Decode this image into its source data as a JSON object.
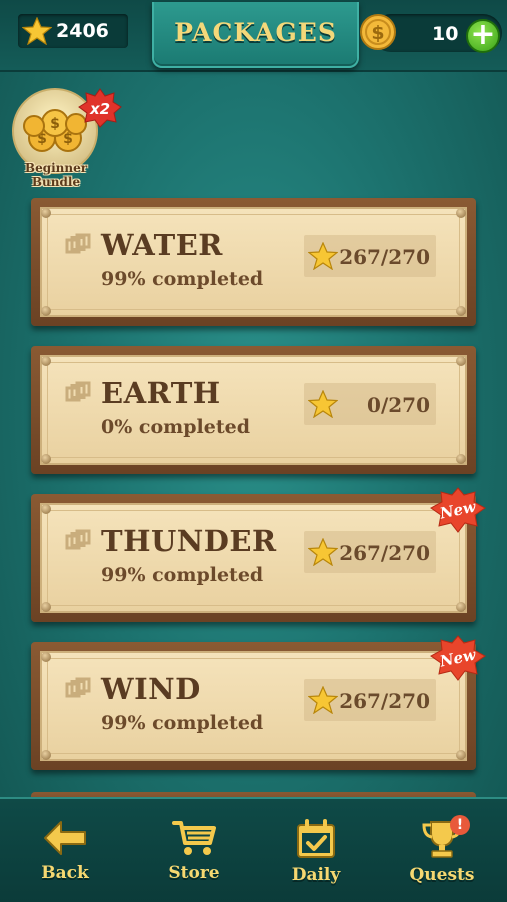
{
  "header": {
    "title": "PACKAGES",
    "stars": "2406",
    "coins": "10",
    "add_label": "+"
  },
  "bundle": {
    "label_line1": "Beginner",
    "label_line2": "Bundle",
    "multiplier": "x2"
  },
  "packages": [
    {
      "name": "WATER",
      "progress": "99% completed",
      "stars": "267/270",
      "is_new": false
    },
    {
      "name": "EARTH",
      "progress": "0% completed",
      "stars": "0/270",
      "is_new": false
    },
    {
      "name": "THUNDER",
      "progress": "99% completed",
      "stars": "267/270",
      "is_new": true
    },
    {
      "name": "WIND",
      "progress": "99% completed",
      "stars": "267/270",
      "is_new": true
    }
  ],
  "new_badge_label": "New",
  "nav": {
    "back": "Back",
    "store": "Store",
    "daily": "Daily",
    "quests": "Quests",
    "quests_alert": "!"
  },
  "colors": {
    "background": "#1d7470",
    "title_gold": "#f4d87a",
    "card_wood": "#7a4d2b",
    "card_paper": "#f2ddb2",
    "accent_green": "#3aa318",
    "badge_red": "#e8593a"
  },
  "icons": [
    "star-icon",
    "coin-icon",
    "plus-icon",
    "knot-icon",
    "back-arrow-icon",
    "cart-icon",
    "calendar-icon",
    "trophy-icon"
  ]
}
